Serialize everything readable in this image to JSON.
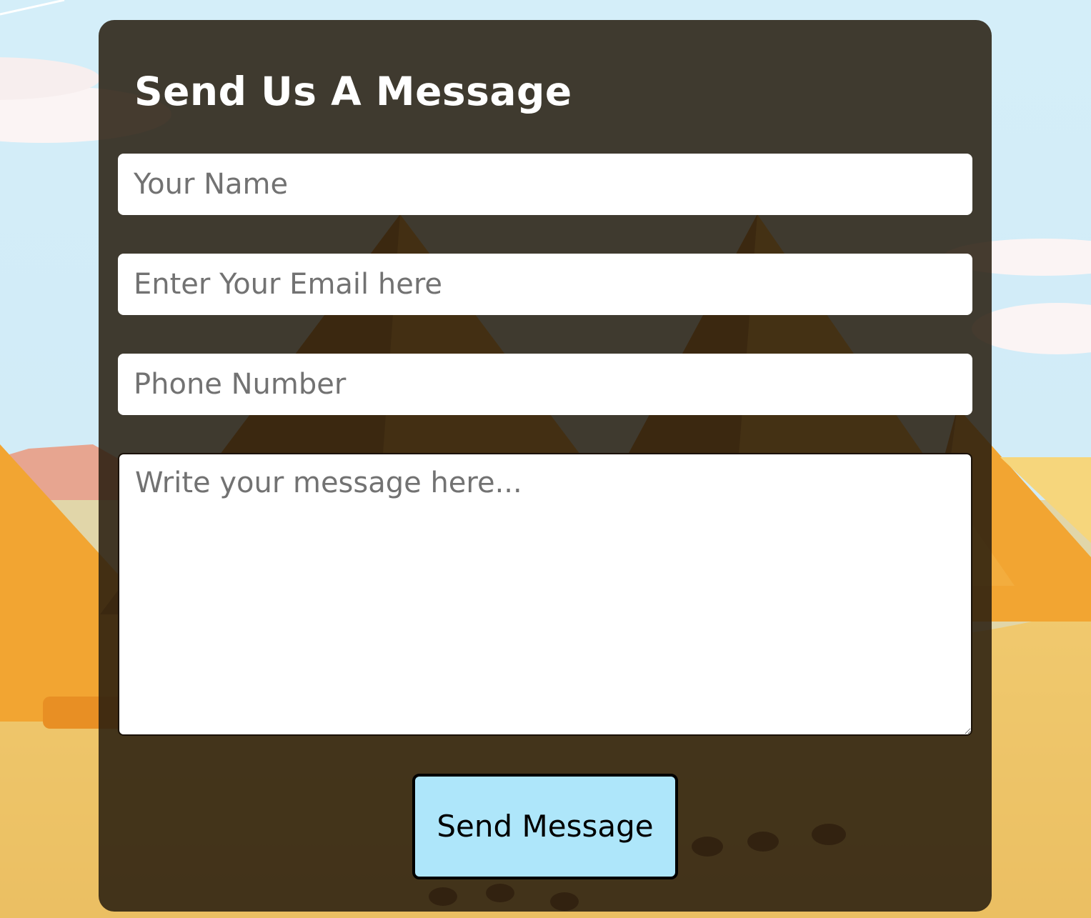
{
  "contact_form": {
    "title": "Send Us A Message",
    "name_placeholder": "Your Name",
    "email_placeholder": "Enter Your Email here",
    "phone_placeholder": "Phone Number",
    "message_placeholder": "Write your message here...",
    "submit_label": "Send Message"
  },
  "background": {
    "scene": "desert-pyramids-with-camel-caravan",
    "colors": {
      "sky": "#d6eef8",
      "sand": "#ecc46a",
      "pyramid": "#f0a533",
      "pyramid_shade": "#b8701c",
      "card_overlay": "#261c0e",
      "button": "#aee6fa"
    }
  }
}
